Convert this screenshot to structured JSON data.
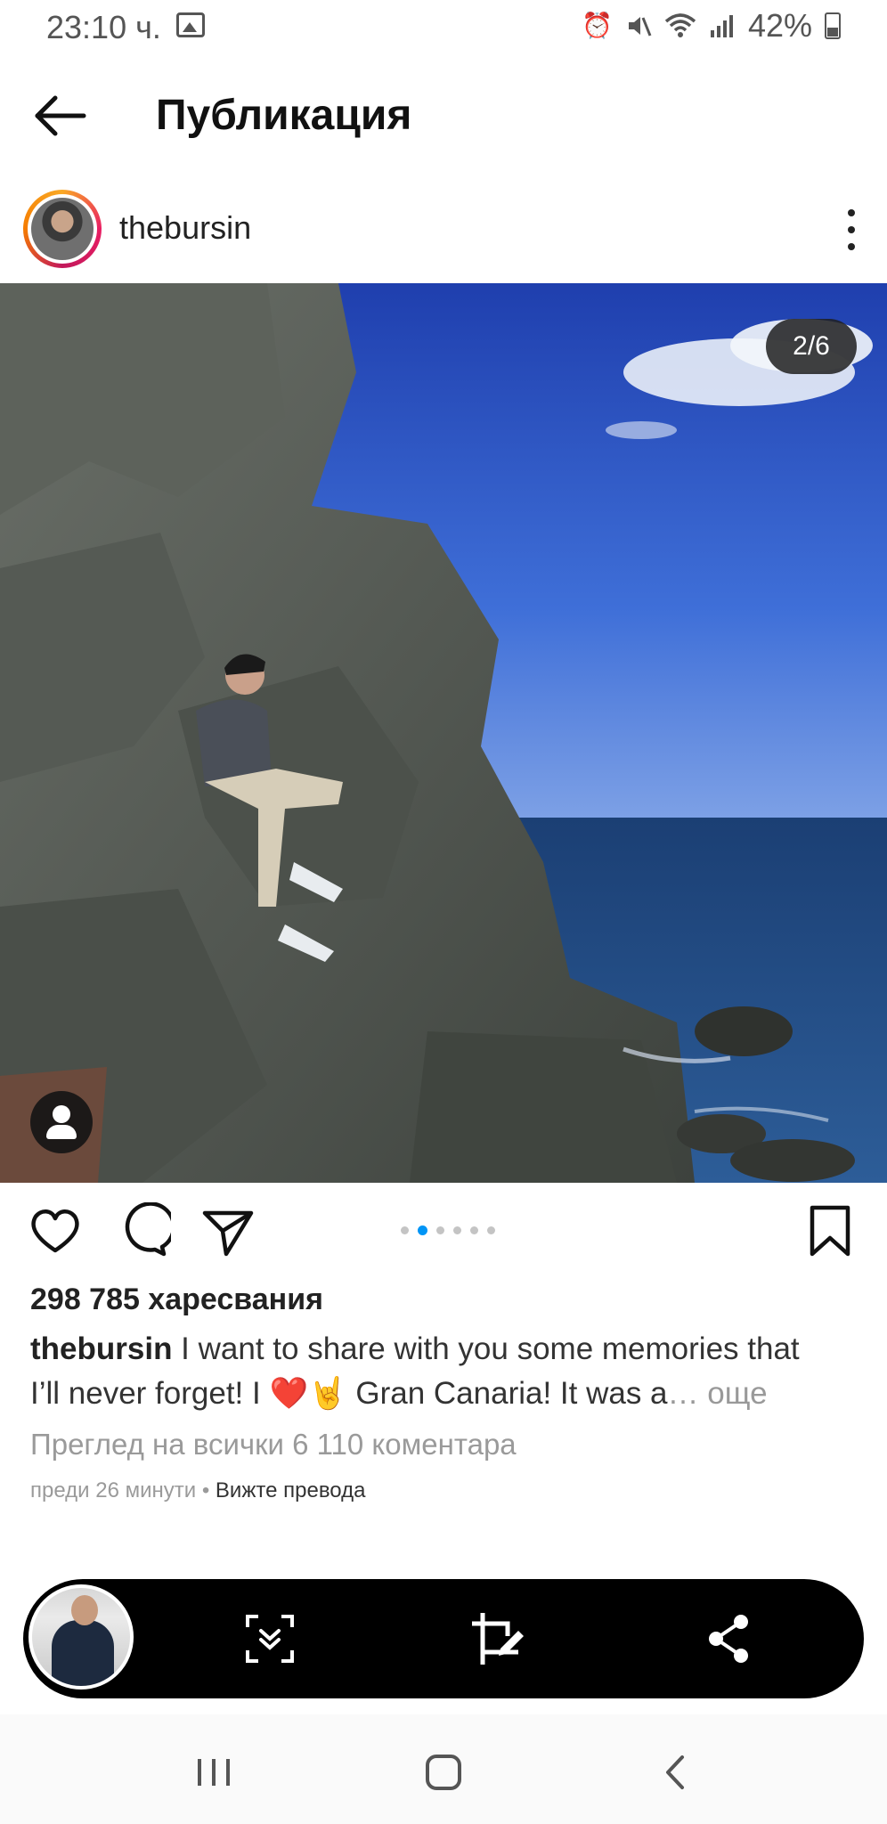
{
  "status_bar": {
    "time": "23:10 ч.",
    "battery": "42%",
    "icons": [
      "gallery-icon",
      "alarm-icon",
      "mute-icon",
      "wifi-icon",
      "signal-icon",
      "battery-icon"
    ]
  },
  "header": {
    "title": "Публикация",
    "back_icon": "arrow-left-icon"
  },
  "post": {
    "username": "thebursin",
    "photo_counter": "2/6",
    "carousel": {
      "count": 6,
      "active_index": 1
    },
    "likes": "298 785 харесвания",
    "caption": {
      "user": "thebursin",
      "text_line1": " I want to share with you some memories that",
      "text_line2_start": "I’ll never forget! I ",
      "heart": "❤️",
      "rock": "🤘",
      "text_line2_end": " Gran Canaria! It was a",
      "ellipsis": "…",
      "more": " още"
    },
    "comments_link": "Преглед на всички 6 110 коментара",
    "time_ago": "преди 26 минути",
    "separator": " • ",
    "translate": "Вижте превода"
  },
  "capture_bar": {
    "buttons": [
      "scroll-capture-icon",
      "crop-edit-icon",
      "share-icon"
    ]
  },
  "nav_bar": {
    "buttons": [
      "recent-apps-icon",
      "home-icon",
      "back-icon"
    ]
  },
  "colors": {
    "accent": "#0095f6",
    "text": "#262626",
    "muted": "#9a9a9a",
    "heart": "#e0202a"
  }
}
